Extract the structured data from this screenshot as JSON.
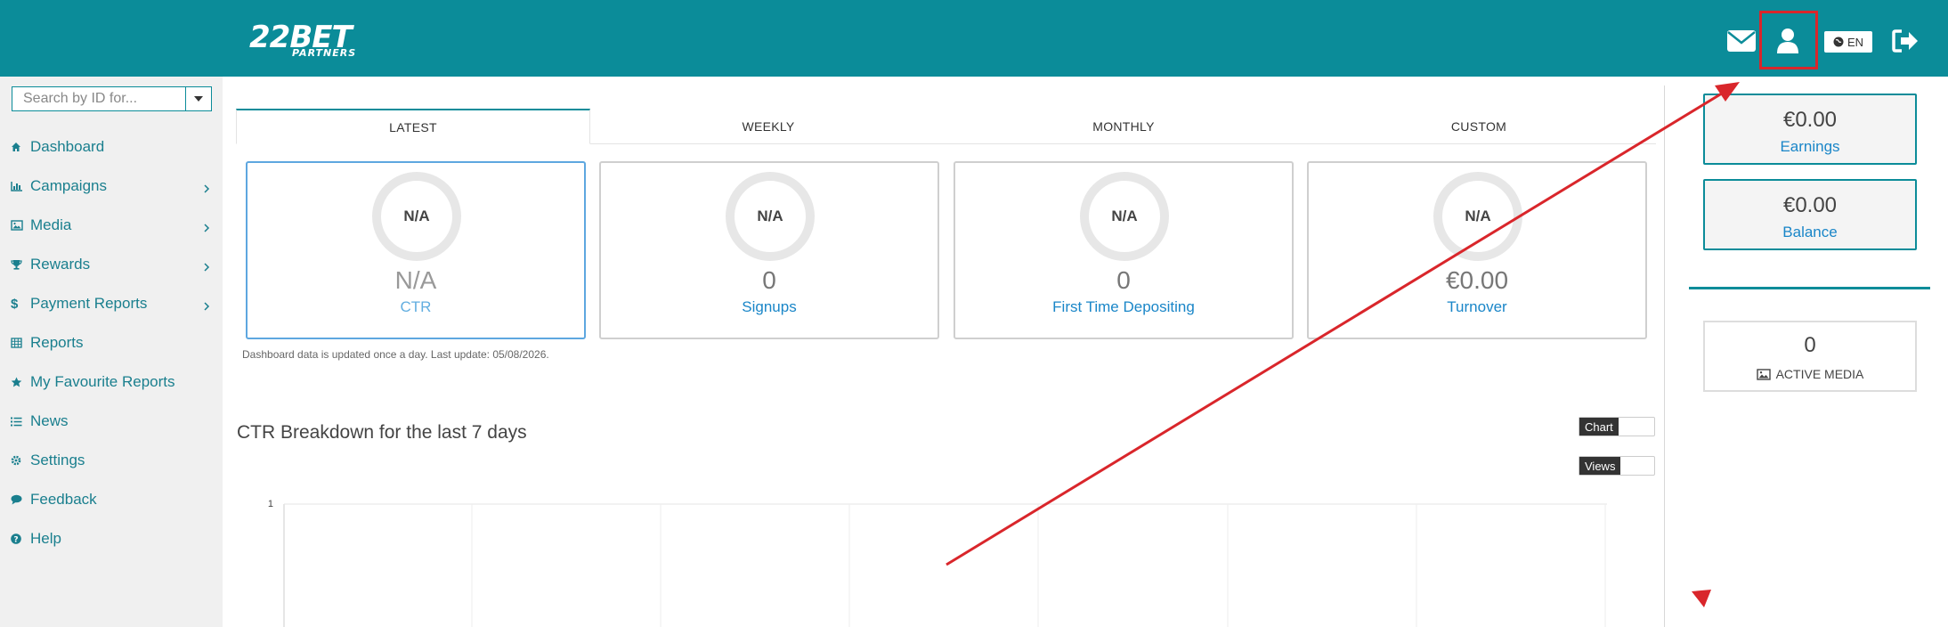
{
  "brand": {
    "logo_big": "22BET",
    "logo_small": "PARTNERS",
    "accent": "#0b8c99",
    "highlight": "#d9262b"
  },
  "header": {
    "mail_icon": "envelope-icon",
    "user_icon": "user-icon",
    "lang": "EN",
    "logout_icon": "sign-out-icon"
  },
  "search": {
    "placeholder": "Search by ID for..."
  },
  "sidebar": {
    "items": [
      {
        "label": "Dashboard",
        "icon": "home-icon"
      },
      {
        "label": "Campaigns",
        "icon": "bar-chart-icon"
      },
      {
        "label": "Media",
        "icon": "image-icon"
      },
      {
        "label": "Rewards",
        "icon": "trophy-icon"
      },
      {
        "label": "Payment Reports",
        "icon": "dollar-icon"
      },
      {
        "label": "Reports",
        "icon": "table-icon"
      },
      {
        "label": "My Favourite Reports",
        "icon": "star-icon"
      },
      {
        "label": "News",
        "icon": "list-icon"
      },
      {
        "label": "Settings",
        "icon": "cog-icon"
      },
      {
        "label": "Feedback",
        "icon": "comment-icon"
      },
      {
        "label": "Help",
        "icon": "question-icon"
      }
    ]
  },
  "tabs": [
    "LATEST",
    "WEEKLY",
    "MONTHLY",
    "CUSTOM"
  ],
  "cards": [
    {
      "donut": "N/A",
      "value": "N/A",
      "label": "CTR"
    },
    {
      "donut": "N/A",
      "value": "0",
      "label": "Signups"
    },
    {
      "donut": "N/A",
      "value": "0",
      "label": "First Time Depositing"
    },
    {
      "donut": "N/A",
      "value": "€0.00",
      "label": "Turnover"
    }
  ],
  "update_note": "Dashboard data is updated once a day. Last update: 05/08/2026.",
  "breakdown": {
    "title": "CTR Breakdown for the last 7 days",
    "chart_toggle": "Chart",
    "views_toggle": "Views",
    "y_tick": "1"
  },
  "right": {
    "earnings_amount": "€0.00",
    "earnings_label": "Earnings",
    "balance_amount": "€0.00",
    "balance_label": "Balance",
    "media_count": "0",
    "media_label": "ACTIVE MEDIA"
  }
}
